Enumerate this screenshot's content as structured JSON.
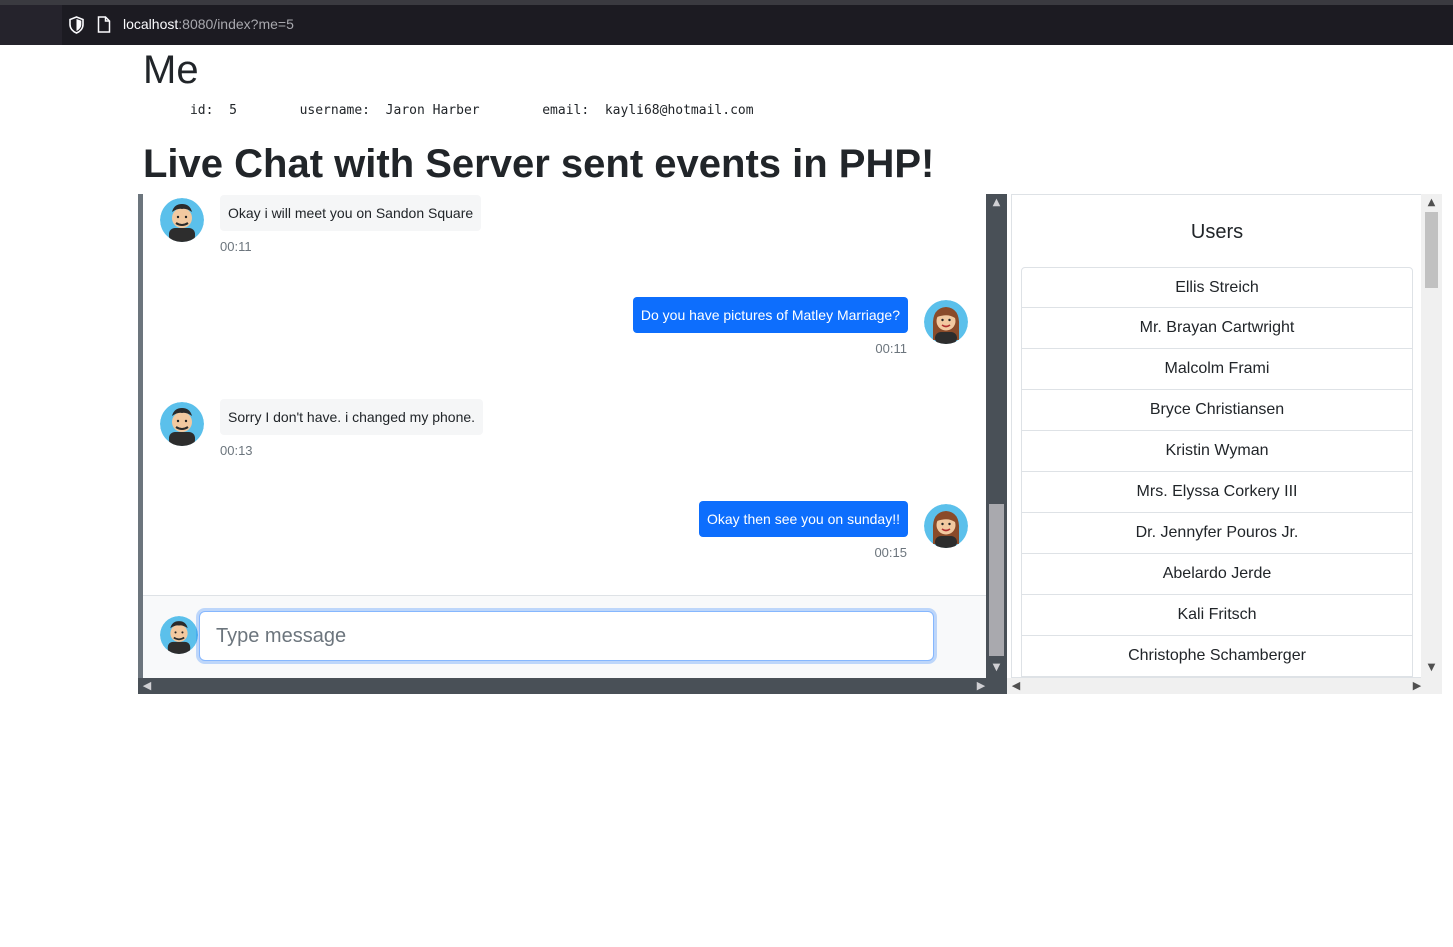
{
  "browser": {
    "url_host": "localhost",
    "url_rest": ":8080/index?me=5"
  },
  "me": {
    "heading": "Me",
    "id_label": "id:",
    "id_value": "5",
    "username_label": "username:",
    "username_value": "Jaron Harber",
    "email_label": "email:",
    "email_value": "kayli68@hotmail.com"
  },
  "page_title": "Live Chat with Server sent events in PHP!",
  "chat": {
    "messages": [
      {
        "direction": "in",
        "text": "Okay i will meet you on Sandon Square",
        "time": "00:11"
      },
      {
        "direction": "out",
        "text": "Do you have pictures of Matley Marriage?",
        "time": "00:11"
      },
      {
        "direction": "in",
        "text": "Sorry I don't have. i changed my phone.",
        "time": "00:13"
      },
      {
        "direction": "out",
        "text": "Okay then see you on sunday!!",
        "time": "00:15"
      }
    ],
    "input_placeholder": "Type message",
    "input_value": ""
  },
  "users": {
    "title": "Users",
    "list": [
      "Ellis Streich",
      "Mr. Brayan Cartwright",
      "Malcolm Frami",
      "Bryce Christiansen",
      "Kristin Wyman",
      "Mrs. Elyssa Corkery III",
      "Dr. Jennyfer Pouros Jr.",
      "Abelardo Jerde",
      "Kali Fritsch",
      "Christophe Schamberger"
    ]
  },
  "colors": {
    "outgoing_bubble": "#0d6efd",
    "incoming_bubble": "#f5f6f7",
    "timestamp": "#6c757d"
  },
  "icons": {
    "tracking_protection": "shield-icon",
    "page_info": "page-icon",
    "male_avatar": "avatar-male-icon",
    "female_avatar": "avatar-female-icon"
  }
}
